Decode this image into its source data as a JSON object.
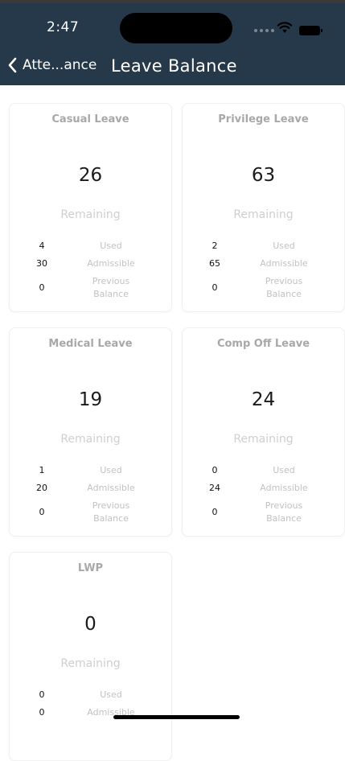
{
  "status_bar": {
    "time": "2:47"
  },
  "nav": {
    "back_label": "Atte...ance",
    "title": "Leave Balance"
  },
  "cards": [
    {
      "title": "Casual Leave",
      "remaining_count": "26",
      "remaining_label": "Remaining",
      "used_value": "4",
      "used_label": "Used",
      "admissible_value": "30",
      "admissible_label": "Admissible",
      "previous_value": "0",
      "previous_label_line1": "Previous",
      "previous_label_line2": "Balance"
    },
    {
      "title": "Privilege Leave",
      "remaining_count": "63",
      "remaining_label": "Remaining",
      "used_value": "2",
      "used_label": "Used",
      "admissible_value": "65",
      "admissible_label": "Admissible",
      "previous_value": "0",
      "previous_label_line1": "Previous",
      "previous_label_line2": "Balance"
    },
    {
      "title": "Medical Leave",
      "remaining_count": "19",
      "remaining_label": "Remaining",
      "used_value": "1",
      "used_label": "Used",
      "admissible_value": "20",
      "admissible_label": "Admissible",
      "previous_value": "0",
      "previous_label_line1": "Previous",
      "previous_label_line2": "Balance"
    },
    {
      "title": "Comp Off Leave",
      "remaining_count": "24",
      "remaining_label": "Remaining",
      "used_value": "0",
      "used_label": "Used",
      "admissible_value": "24",
      "admissible_label": "Admissible",
      "previous_value": "0",
      "previous_label_line1": "Previous",
      "previous_label_line2": "Balance"
    },
    {
      "title": "LWP",
      "remaining_count": "0",
      "remaining_label": "Remaining",
      "used_value": "0",
      "used_label": "Used",
      "admissible_value": "0",
      "admissible_label": "Admissible"
    }
  ],
  "colors": {
    "header_bg": "#26394a",
    "title_text": "#a8a8a8",
    "muted_text": "#c2c2c2",
    "count_text": "#1a1a1a"
  },
  "icons": {
    "back": "chevron-left-icon",
    "wifi": "wifi-icon",
    "battery": "battery-icon"
  }
}
